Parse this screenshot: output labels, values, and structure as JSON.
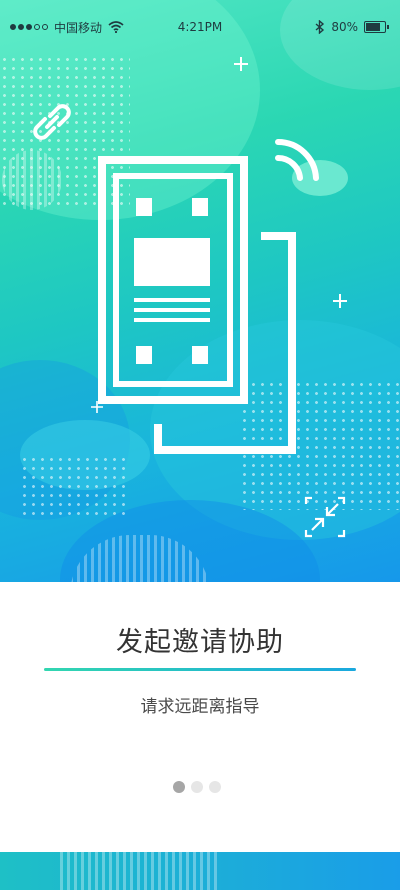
{
  "status_bar": {
    "carrier": "中国移动",
    "time": "4:21PM",
    "battery_percent": "80%",
    "battery_level": 0.8,
    "icons": [
      "signal-dots-icon",
      "wifi-icon",
      "bluetooth-icon",
      "battery-icon"
    ]
  },
  "onboarding": {
    "title": "发起邀请协助",
    "subtitle": "请求远距离指导",
    "page_count": 3,
    "current_page": 1
  },
  "colors": {
    "gradient_start": "#52e6c4",
    "gradient_end": "#1698ea",
    "divider_start": "#32d6b0",
    "divider_end": "#1aa8de",
    "dot_active": "#a6a6a6",
    "dot_inactive": "#e6e6e6"
  },
  "illustration_icons": [
    "link-icon",
    "wireless-signal-icon",
    "phone-qr-scan-icon",
    "collapse-arrows-icon",
    "plus-icon"
  ]
}
